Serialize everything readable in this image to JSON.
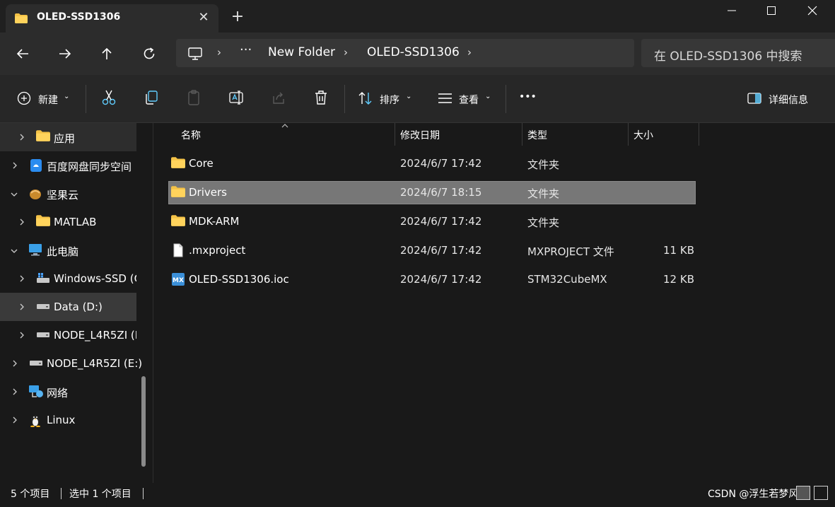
{
  "window": {
    "tab_title": "OLED-SSD1306",
    "new_tab": "+"
  },
  "nav": {
    "breadcrumb": [
      "New Folder",
      "OLED-SSD1306"
    ],
    "more": "···",
    "search_placeholder": "在 OLED-SSD1306 中搜索"
  },
  "toolbar": {
    "new_label": "新建",
    "sort_label": "排序",
    "view_label": "查看",
    "more": "•••",
    "details_label": "详细信息"
  },
  "sidebar": {
    "items": [
      {
        "label": "应用",
        "icon": "folder-icon",
        "state": "selected"
      },
      {
        "label": "百度网盘同步空间",
        "icon": "baidu-netdisk-icon"
      },
      {
        "label": "坚果云",
        "icon": "nutstore-icon",
        "expanded": true
      },
      {
        "label": "MATLAB",
        "icon": "folder-icon"
      },
      {
        "label": "此电脑",
        "icon": "monitor-icon",
        "expanded": true
      },
      {
        "label": "Windows-SSD (C",
        "icon": "drive-c-icon"
      },
      {
        "label": "Data (D:)",
        "icon": "drive-icon",
        "state": "hover"
      },
      {
        "label": "NODE_L4R5ZI (E",
        "icon": "drive-icon"
      },
      {
        "label": "NODE_L4R5ZI (E:)",
        "icon": "drive-icon"
      },
      {
        "label": "网络",
        "icon": "network-icon"
      },
      {
        "label": "Linux",
        "icon": "linux-penguin-icon"
      }
    ]
  },
  "columns": {
    "name": "名称",
    "date": "修改日期",
    "type": "类型",
    "size": "大小"
  },
  "files": [
    {
      "name": "Core",
      "date": "2024/6/7 17:42",
      "type": "文件夹",
      "size": "",
      "icon": "folder-icon"
    },
    {
      "name": "Drivers",
      "date": "2024/6/7 18:15",
      "type": "文件夹",
      "size": "",
      "icon": "folder-icon",
      "selected": true
    },
    {
      "name": "MDK-ARM",
      "date": "2024/6/7 17:42",
      "type": "文件夹",
      "size": "",
      "icon": "folder-icon"
    },
    {
      "name": ".mxproject",
      "date": "2024/6/7 17:42",
      "type": "MXPROJECT 文件",
      "size": "11 KB",
      "icon": "file-icon"
    },
    {
      "name": "OLED-SSD1306.ioc",
      "date": "2024/6/7 17:42",
      "type": "STM32CubeMX",
      "size": "12 KB",
      "icon": "stm32cubemx-icon"
    }
  ],
  "status": {
    "count": "5 个项目",
    "selected": "选中 1 个项目",
    "watermark": "CSDN @浮生若梦风"
  },
  "colors": {
    "selection": "#777777",
    "folder": "#f4c247",
    "accent": "#60cdff"
  }
}
